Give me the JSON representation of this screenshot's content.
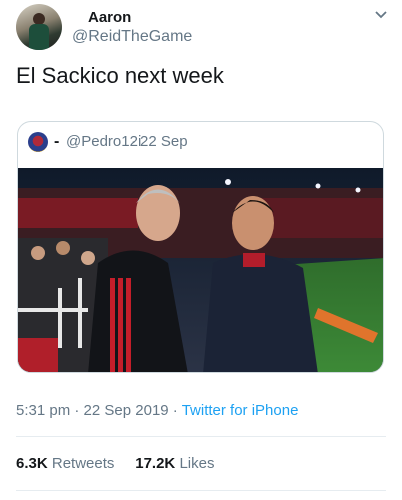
{
  "author": {
    "name": "Aaron",
    "handle": "@ReidTheGame"
  },
  "tweet_text": "El Sackico next week",
  "quoted": {
    "dash": "-",
    "handle": "@Pedro12i",
    "separator": "·",
    "date": "22 Sep",
    "photo_icon": "photo-two-managers-handshake"
  },
  "meta": {
    "time": "5:31 pm",
    "sep1": "·",
    "date": "22 Sep 2019",
    "sep2": "·",
    "source": "Twitter for iPhone"
  },
  "stats": {
    "retweets_count": "6.3K",
    "retweets_label": "Retweets",
    "likes_count": "17.2K",
    "likes_label": "Likes"
  },
  "colors": {
    "link": "#1da1f2",
    "secondary": "#657786",
    "border": "#cfd9de"
  }
}
